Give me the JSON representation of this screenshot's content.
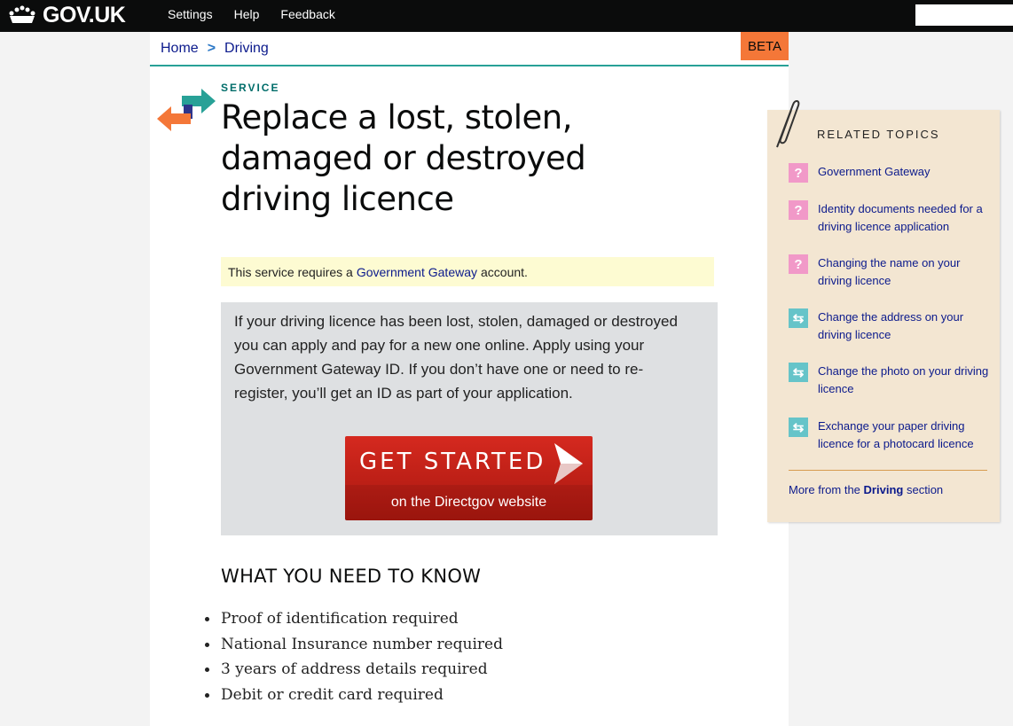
{
  "header": {
    "logo_text": "GOV.UK",
    "nav": [
      "Settings",
      "Help",
      "Feedback"
    ],
    "search_placeholder": ""
  },
  "breadcrumb": [
    "Home",
    "Driving"
  ],
  "badge": "BETA",
  "page": {
    "kicker": "SERVICE",
    "title": "Replace a lost, stolen, damaged or destroyed driving licence"
  },
  "notice": {
    "prefix": "This service requires a",
    "link": "Government Gateway",
    "suffix": "account."
  },
  "callout": {
    "text": "If your driving licence has been lost, stolen, damaged or destroyed you can apply and pay for a new one online. Apply using your Government Gateway ID. If you don’t have one or need to re-register, you’ll get an ID as part of your application.",
    "button_main": "GET STARTED",
    "button_sub": "on the Directgov website"
  },
  "know": {
    "heading": "WHAT YOU NEED TO KNOW",
    "items": [
      "Proof of identification required",
      "National Insurance number required",
      "3 years of address details required",
      "Debit or credit card required"
    ]
  },
  "related": {
    "title": "RELATED TOPICS",
    "items": [
      {
        "icon": "question-icon",
        "label": "Government Gateway"
      },
      {
        "icon": "question-icon",
        "label": "Identity documents needed for a driving licence application"
      },
      {
        "icon": "question-icon",
        "label": "Changing the name on your driving licence"
      },
      {
        "icon": "swap-arrows-icon",
        "label": "Change the address on your driving licence"
      },
      {
        "icon": "swap-arrows-icon",
        "label": "Change the photo on your driving licence"
      },
      {
        "icon": "swap-arrows-icon",
        "label": "Exchange your paper driving licence for a photocard licence"
      }
    ],
    "more_prefix": "More from the",
    "more_bold": "Driving",
    "more_suffix": "section"
  },
  "colors": {
    "header_bg": "#0b0c0c",
    "beta_orange": "#f47738",
    "teal": "#28a197",
    "cta_red": "#c4221a",
    "related_bg": "#f3e6d2"
  }
}
